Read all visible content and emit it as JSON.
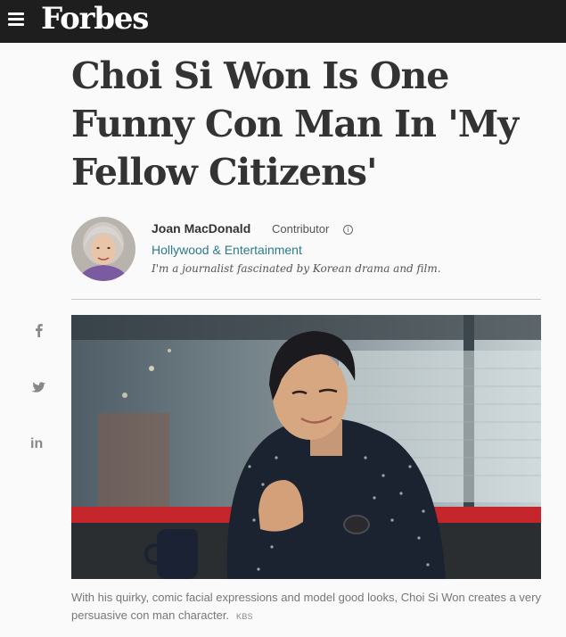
{
  "header": {
    "logo": "Forbes",
    "menu_icon": "hamburger-menu-icon",
    "background": "#1e1e1e"
  },
  "article": {
    "title": "Choi Si Won Is One Funny Con Man In 'My Fellow Citizens'",
    "author": {
      "name": "Joan MacDonald",
      "role": "Contributor",
      "channel": "Hollywood & Entertainment",
      "bio": "I'm a journalist fascinated by Korean drama and film."
    },
    "share": {
      "facebook_icon": "facebook-icon",
      "twitter_icon": "twitter-icon",
      "linkedin_icon": "linkedin-icon",
      "linkedin_glyph": "in"
    },
    "image": {
      "caption": "With his quirky, comic facial expressions and model good looks, Choi Si Won creates a very persuasive con man character.",
      "credit": "KBS"
    }
  },
  "colors": {
    "channel_link": "#2c7a8e",
    "text": "#333333",
    "page_bg": "#fafafa"
  }
}
